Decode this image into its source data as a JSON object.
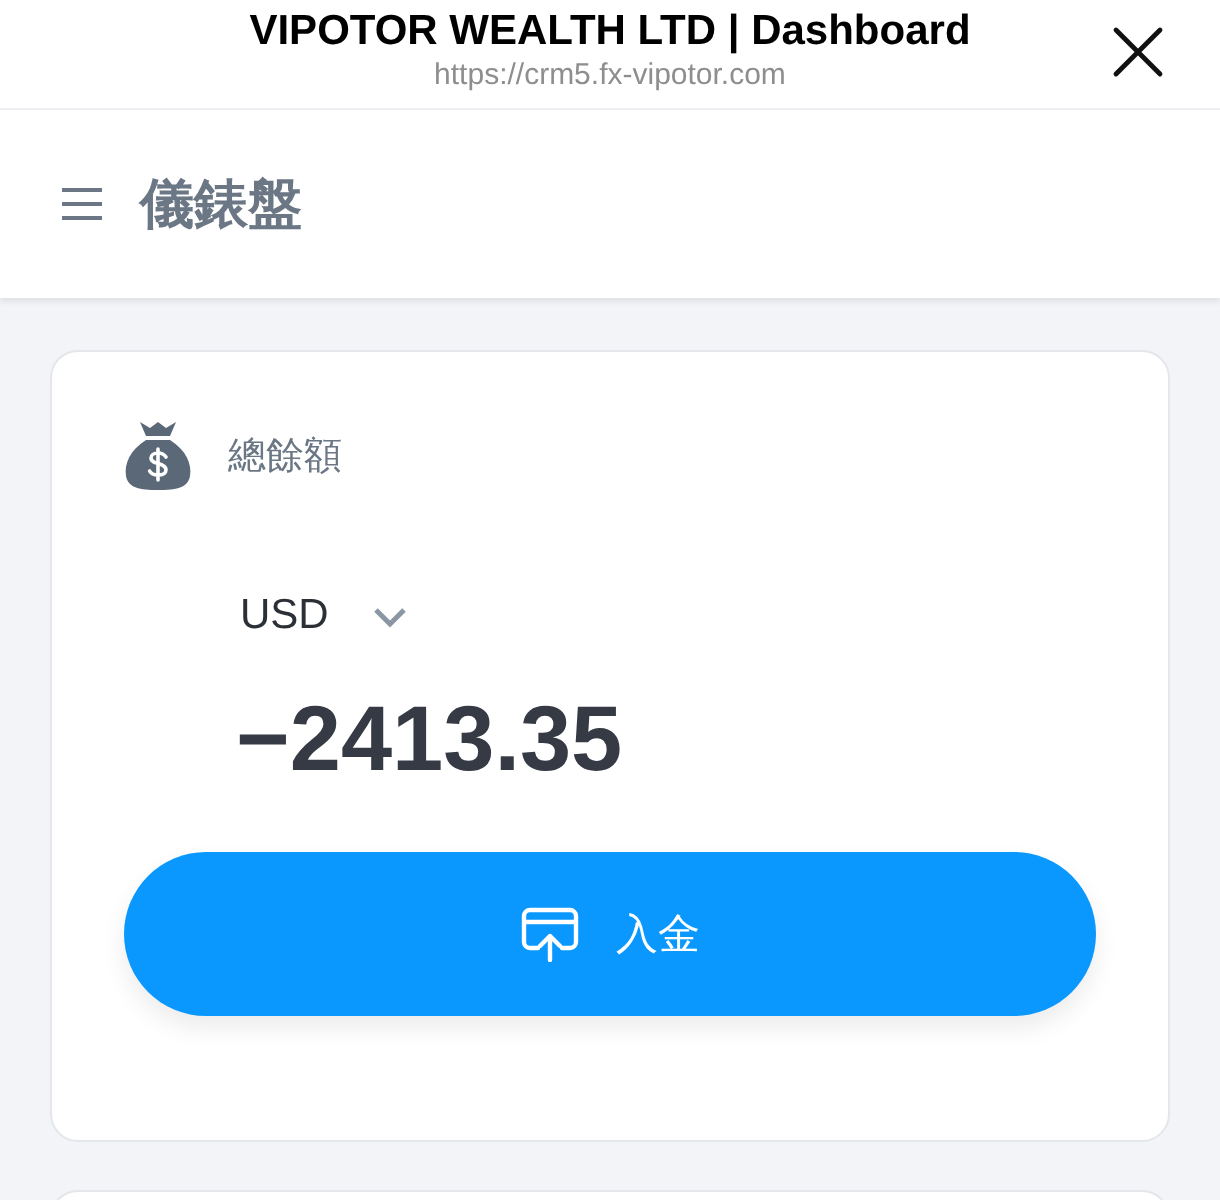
{
  "browser": {
    "title": "VIPOTOR WEALTH LTD | Dashboard",
    "url": "https://crm5.fx-vipotor.com"
  },
  "header": {
    "title": "儀錶盤"
  },
  "balance_card": {
    "label": "總餘額",
    "currency": "USD",
    "amount": "−2413.35",
    "button": "入金"
  }
}
